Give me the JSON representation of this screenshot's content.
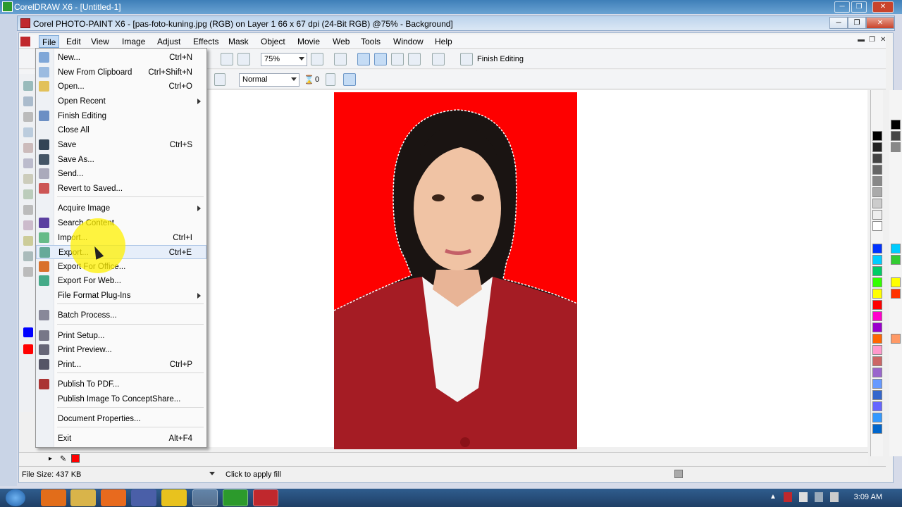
{
  "outer_window": {
    "title": "CorelDRAW X6 - [Untitled-1]"
  },
  "window": {
    "title": "Corel PHOTO-PAINT X6 - [pas-foto-kuning.jpg (RGB) on Layer 1 66 x 67 dpi  (24-Bit RGB) @75% - Background]"
  },
  "menubar": {
    "items": [
      "File",
      "Edit",
      "View",
      "Image",
      "Adjust",
      "Effects",
      "Mask",
      "Object",
      "Movie",
      "Web",
      "Tools",
      "Window",
      "Help"
    ]
  },
  "toolbar": {
    "zoom": "75%",
    "finish_editing": "Finish Editing"
  },
  "property_bar": {
    "merge_mode": "Normal",
    "transparency": "0"
  },
  "file_menu": {
    "items": [
      {
        "label": "New...",
        "shortcut": "Ctrl+N"
      },
      {
        "label": "New From Clipboard",
        "shortcut": "Ctrl+Shift+N"
      },
      {
        "label": "Open...",
        "shortcut": "Ctrl+O"
      },
      {
        "label": "Open Recent",
        "shortcut": ""
      },
      {
        "label": "Finish Editing",
        "shortcut": ""
      },
      {
        "label": "Close All",
        "shortcut": ""
      },
      {
        "label": "Save",
        "shortcut": "Ctrl+S"
      },
      {
        "label": "Save As...",
        "shortcut": ""
      },
      {
        "label": "Send...",
        "shortcut": ""
      },
      {
        "label": "Revert to Saved...",
        "shortcut": ""
      },
      {
        "label": "Acquire Image",
        "shortcut": ""
      },
      {
        "label": "Search Content",
        "shortcut": ""
      },
      {
        "label": "Import...",
        "shortcut": "Ctrl+I"
      },
      {
        "label": "Export...",
        "shortcut": "Ctrl+E"
      },
      {
        "label": "Export For Office...",
        "shortcut": ""
      },
      {
        "label": "Export For Web...",
        "shortcut": ""
      },
      {
        "label": "File Format Plug-Ins",
        "shortcut": ""
      },
      {
        "label": "Batch Process...",
        "shortcut": ""
      },
      {
        "label": "Print Setup...",
        "shortcut": ""
      },
      {
        "label": "Print Preview...",
        "shortcut": ""
      },
      {
        "label": "Print...",
        "shortcut": "Ctrl+P"
      },
      {
        "label": "Publish To PDF...",
        "shortcut": ""
      },
      {
        "label": "Publish Image To ConceptShare...",
        "shortcut": ""
      },
      {
        "label": "Document Properties...",
        "shortcut": ""
      },
      {
        "label": "Exit",
        "shortcut": "Alt+F4"
      }
    ]
  },
  "status_bar": {
    "file_size": "File Size: 437 KB",
    "hint": "Click to apply fill"
  },
  "taskbar": {
    "clock": "3:09 AM"
  },
  "colors": {
    "fill_color": "#fe0000",
    "photo_background": "#fe0000",
    "jacket": "#a51c24"
  }
}
